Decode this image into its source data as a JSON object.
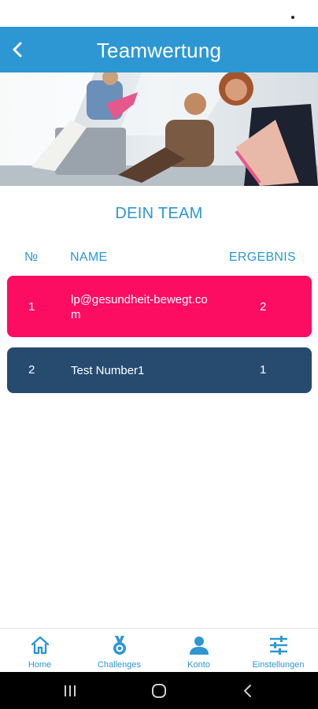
{
  "header": {
    "title": "Teamwertung"
  },
  "team": {
    "section_title": "DEIN TEAM",
    "columns": {
      "no": "№",
      "name": "NAME",
      "result": "ERGEBNIS"
    },
    "rows": [
      {
        "rank": "1",
        "name": "lp@gesundheit-bewegt.com",
        "score": "2"
      },
      {
        "rank": "2",
        "name": "Test Number1",
        "score": "1"
      }
    ]
  },
  "bottom_nav": {
    "items": [
      {
        "label": "Home",
        "icon": "home-icon"
      },
      {
        "label": "Challenges",
        "icon": "medal-icon"
      },
      {
        "label": "Konto",
        "icon": "person-icon"
      },
      {
        "label": "Einstellungen",
        "icon": "sliders-icon"
      }
    ]
  },
  "colors": {
    "primary": "#2d97d3",
    "row_highlight": "#fc0d62",
    "row_default": "#274b6f"
  }
}
